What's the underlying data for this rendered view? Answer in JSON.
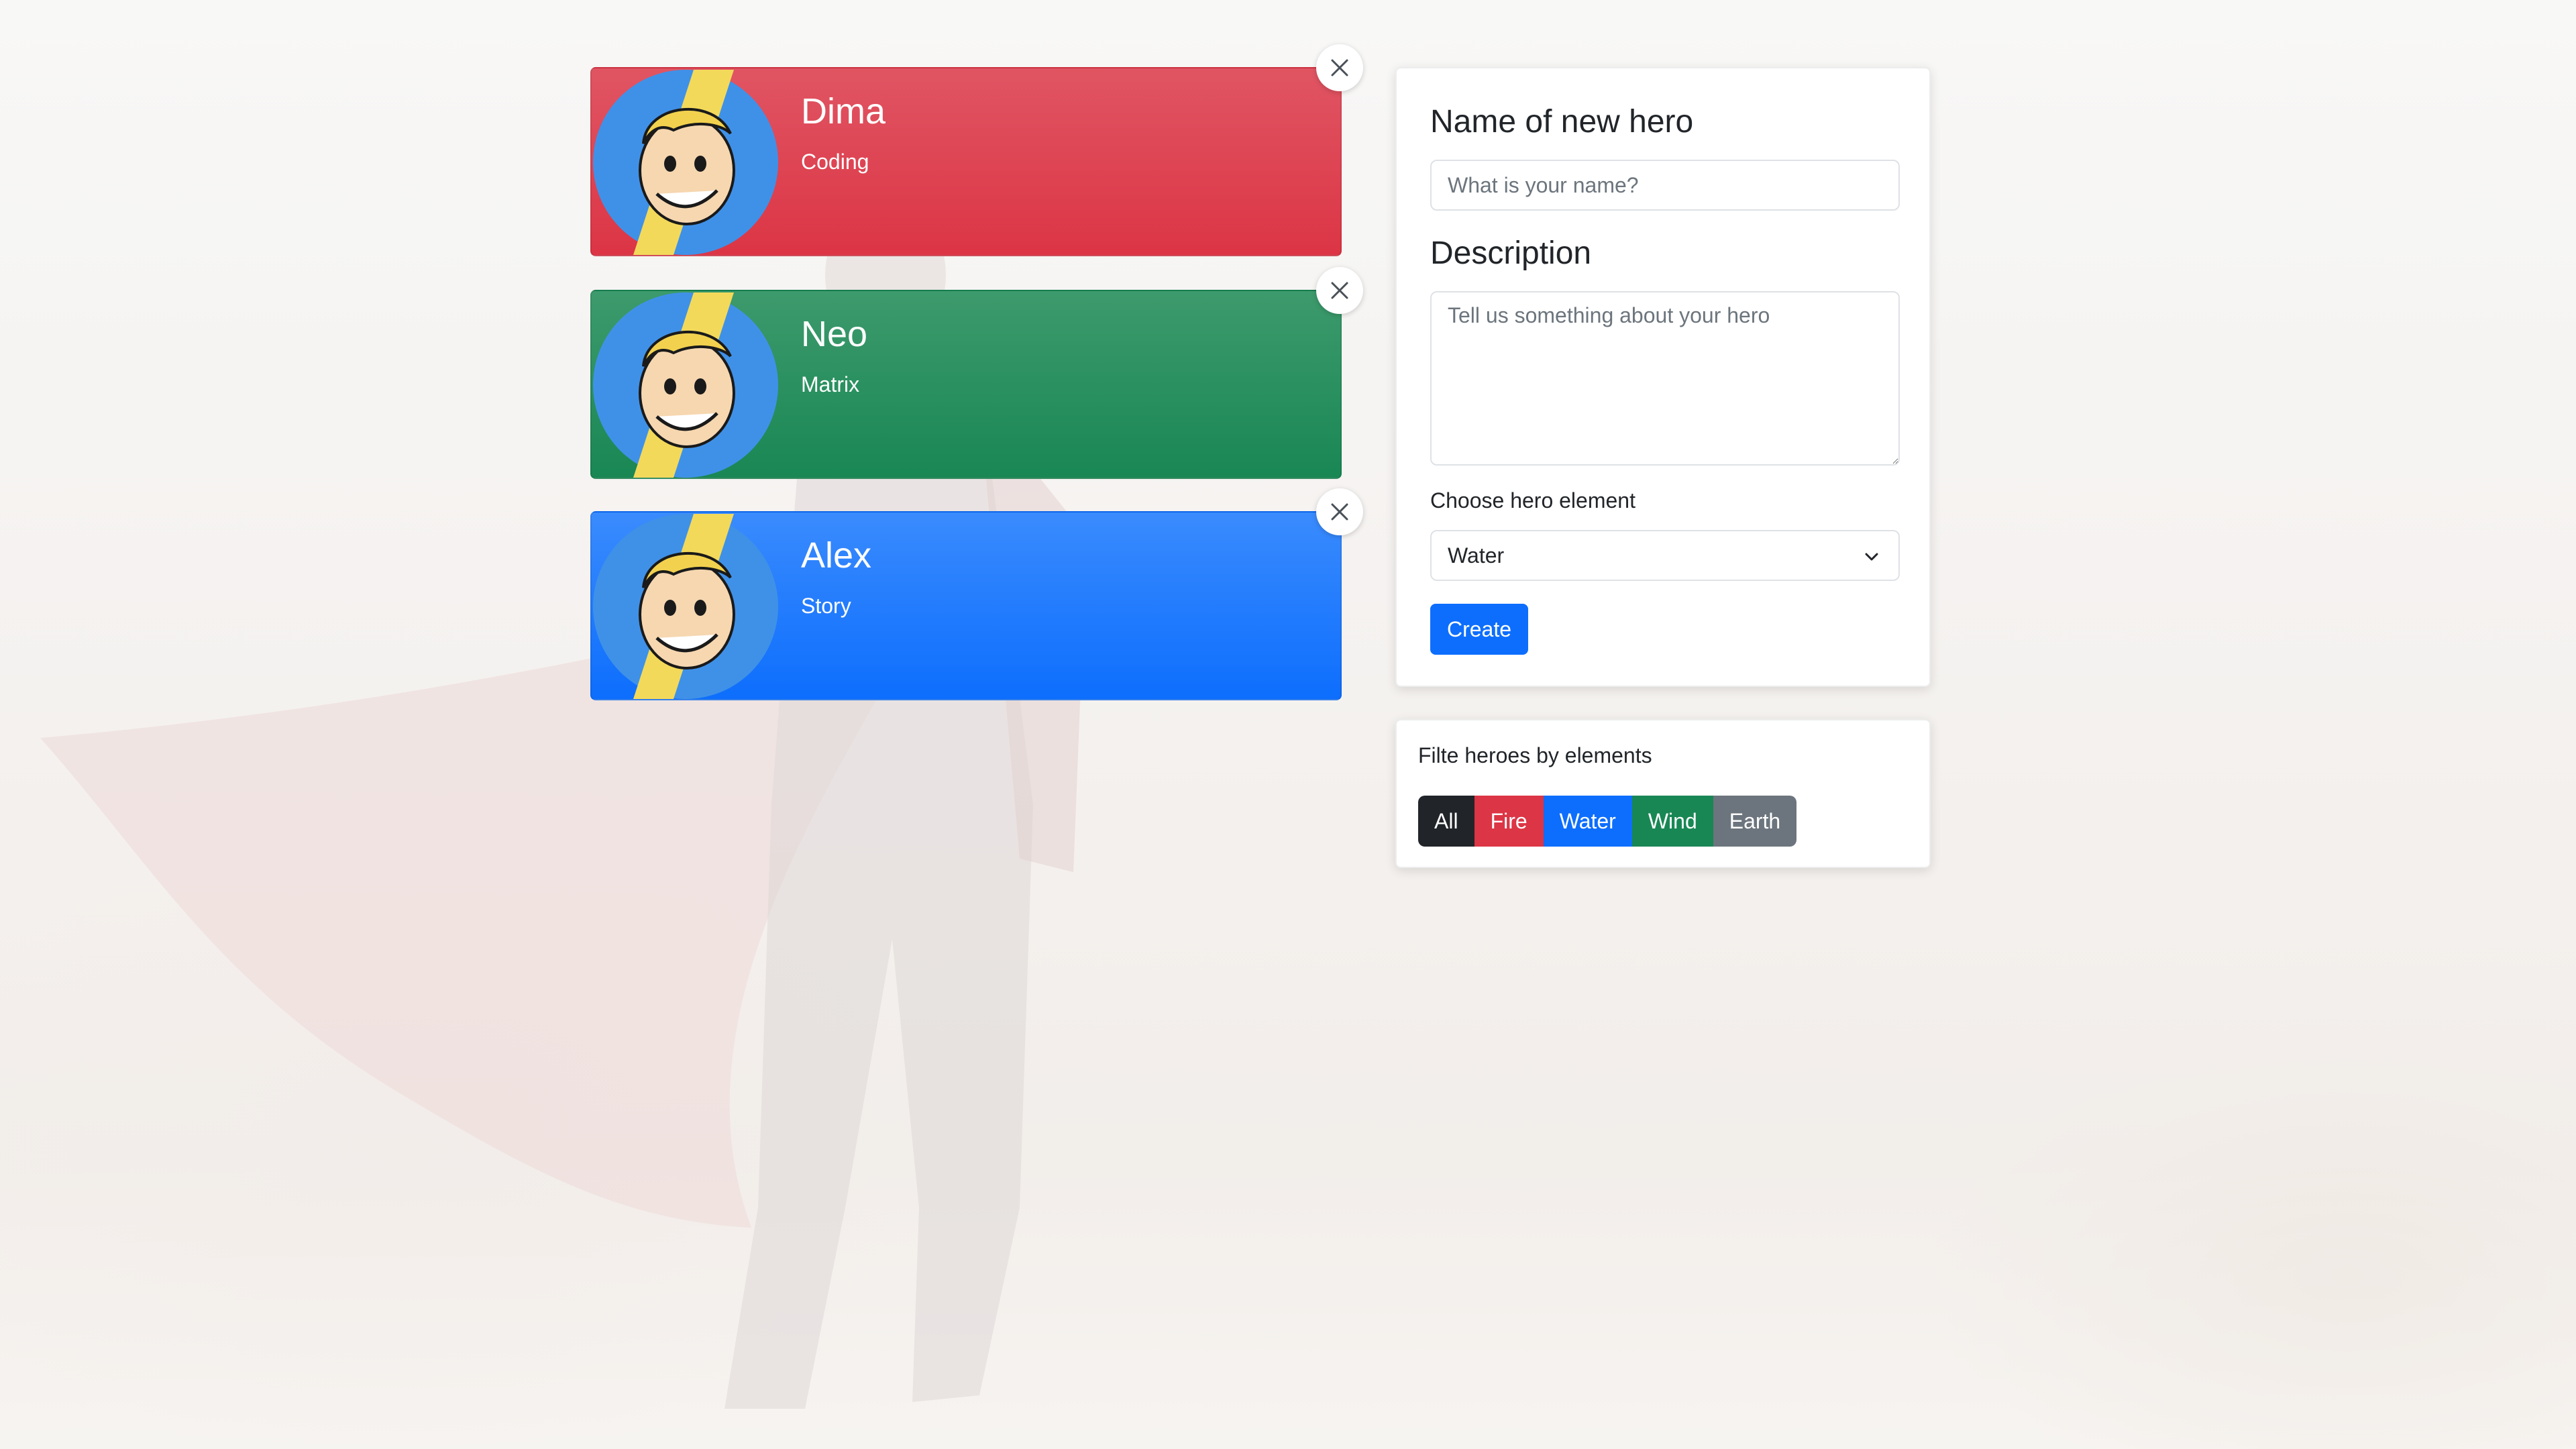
{
  "heroes": [
    {
      "name": "Dima",
      "description": "Coding",
      "element": "fire",
      "color": "#dc3545"
    },
    {
      "name": "Neo",
      "description": "Matrix",
      "element": "wind",
      "color": "#198754"
    },
    {
      "name": "Alex",
      "description": "Story",
      "element": "water",
      "color": "#0d6efd"
    }
  ],
  "form": {
    "name_label": "Name of new hero",
    "name_placeholder": "What is your name?",
    "description_label": "Description",
    "description_placeholder": "Tell us something about your hero",
    "element_label": "Choose hero element",
    "element_selected": "Water",
    "create_label": "Create"
  },
  "filter": {
    "title": "Filte heroes by elements",
    "buttons": [
      {
        "label": "All",
        "color": "#212529"
      },
      {
        "label": "Fire",
        "color": "#dc3545"
      },
      {
        "label": "Water",
        "color": "#0d6efd"
      },
      {
        "label": "Wind",
        "color": "#198754"
      },
      {
        "label": "Earth",
        "color": "#6c757d"
      }
    ]
  },
  "icons": {
    "avatar": "vault-boy-avatar-icon",
    "close": "close-icon",
    "chevron": "chevron-down-icon"
  }
}
